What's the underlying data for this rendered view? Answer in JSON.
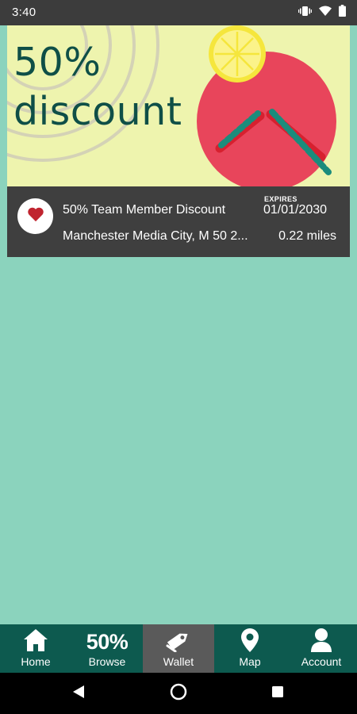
{
  "status_bar": {
    "time": "3:40"
  },
  "offer": {
    "banner_line1": "50%",
    "banner_line2": "discount",
    "title": "50% Team Member Discount",
    "location": "Manchester Media City, M 50 2...",
    "expires_label": "EXPIRES",
    "expires_date": "01/01/2030",
    "distance": "0.22 miles"
  },
  "bottom_nav": {
    "items": [
      {
        "label": "Home",
        "icon": "home-icon"
      },
      {
        "label": "Browse",
        "icon_text": "50%"
      },
      {
        "label": "Wallet",
        "icon": "tag-icon",
        "active": true
      },
      {
        "label": "Map",
        "icon": "map-pin-icon"
      },
      {
        "label": "Account",
        "icon": "person-icon"
      }
    ]
  },
  "colors": {
    "background": "#8bd3bd",
    "nav": "#0d5a4f",
    "nav_active": "#5a5a5a",
    "card": "#3f3f3f",
    "banner": "#eef4ae",
    "accent_red": "#e8455b",
    "heart": "#c0242f"
  }
}
